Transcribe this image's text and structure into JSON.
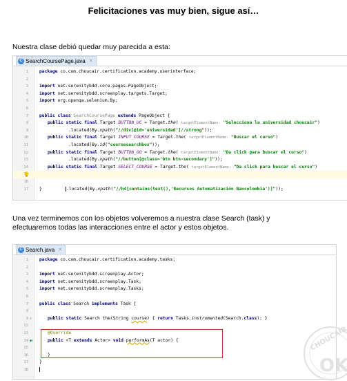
{
  "heading": "Felicitaciones  vas muy bien, sigue así…",
  "intro": "Nuestra clase debió quedar muy parecida a esta:",
  "middle_line1": "Una vez terminemos con los objetos volveremos a nuestra clase Search (task) y",
  "middle_line2": "efectuaremos todas las interacciones entre el actor y estos objetos.",
  "watermark": "CHOUCAIR OK",
  "editor1": {
    "tab": "SearchCoursePage.java",
    "lines": [
      {
        "n": "1",
        "t": "package co.com.choucair.certification.academy.userinterface;"
      },
      {
        "n": "2",
        "t": ""
      },
      {
        "n": "3",
        "t": "import net.serenitybdd.core.pages.PageObject;"
      },
      {
        "n": "4",
        "t": "import net.serenitybdd.screenplay.targets.Target;"
      },
      {
        "n": "5",
        "t": "import org.openqa.selenium.By;"
      },
      {
        "n": "6",
        "t": ""
      },
      {
        "n": "7",
        "t": "public class SearchCoursePage extends PageObject {"
      },
      {
        "n": "8",
        "t": "public static final Target BUTTON_UC = Target.the( targetElementName: \"Selecciona la universidad choucair\")"
      },
      {
        "n": "9",
        "t": ".located(By.xpath(\"//div[@id='universidad']//strong\"));"
      },
      {
        "n": "10",
        "t": "public static final Target INPUT_COURSE = Target.the( targetElementName: \"Buscar el curso\")"
      },
      {
        "n": "11",
        "t": ".located(By.id(\"coursesearchbox\"));"
      },
      {
        "n": "12",
        "t": "public static final Target BUTTON_GO = Target.the( targetElementName: \"Da click para buscar el curso\")"
      },
      {
        "n": "13",
        "t": ".located(By.xpath(\"//button[@class='btn btn-secondary']\"));"
      },
      {
        "n": "14",
        "t": "public static final Target SELECT_COURSE = Target.the( targetElementName: \"Da click para buscar el curso\")"
      },
      {
        "n": "15",
        "t": ".located(By.xpath(\"//h4[contains(text(),'Recursos Automatización Bancolombia')]\"));"
      },
      {
        "n": "16",
        "t": ""
      },
      {
        "n": "17",
        "t": "}"
      }
    ]
  },
  "editor2": {
    "tab": "Search.java",
    "lines": [
      {
        "n": "1",
        "t": "package co.com.choucair.certification.academy.tasks;"
      },
      {
        "n": "2",
        "t": ""
      },
      {
        "n": "3",
        "t": "import net.serenitybdd.screenplay.Actor;"
      },
      {
        "n": "4",
        "t": "import net.serenitybdd.screenplay.Task;"
      },
      {
        "n": "5",
        "t": "import net.serenitybdd.screenplay.Tasks;"
      },
      {
        "n": "6",
        "t": ""
      },
      {
        "n": "7",
        "t": "public class Search implements Task {"
      },
      {
        "n": "8",
        "t": ""
      },
      {
        "n": "9",
        "t": "public static Search the(String course) { return Tasks.instrumented(Search.class); }"
      },
      {
        "n": "12",
        "t": ""
      },
      {
        "n": "13",
        "t": "@Override"
      },
      {
        "n": "14",
        "t": "public <T extends Actor> void performAs(T actor) {"
      },
      {
        "n": "15",
        "t": ""
      },
      {
        "n": "16",
        "t": "}"
      },
      {
        "n": "17",
        "t": "}"
      },
      {
        "n": "18",
        "t": ""
      }
    ]
  }
}
